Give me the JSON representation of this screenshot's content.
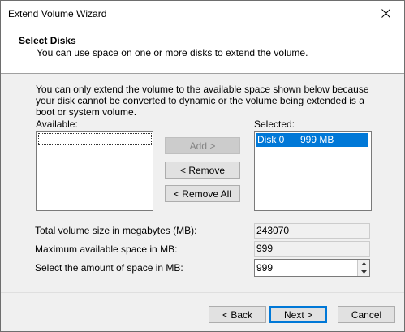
{
  "window": {
    "title": "Extend Volume Wizard"
  },
  "header": {
    "title": "Select Disks",
    "subtitle": "You can use space on one or more disks to extend the volume."
  },
  "info": {
    "text": "You can only extend the volume to the available space shown below because your disk cannot be converted to dynamic or the volume being extended is a boot or system volume."
  },
  "available": {
    "label": "Available:",
    "items": []
  },
  "selected": {
    "label": "Selected:",
    "items": [
      {
        "disk": "Disk 0",
        "size": "999 MB"
      }
    ]
  },
  "buttons": {
    "add": "Add >",
    "remove": "< Remove",
    "remove_all": "< Remove All",
    "back": "< Back",
    "next": "Next >",
    "cancel": "Cancel"
  },
  "fields": {
    "total_label": "Total volume size in megabytes (MB):",
    "total_value": "243070",
    "max_label": "Maximum available space in MB:",
    "max_value": "999",
    "amount_label": "Select the amount of space in MB:",
    "amount_value": "999"
  },
  "icons": {
    "close": "close-icon",
    "spin_up": "spin-up-icon",
    "spin_down": "spin-down-icon"
  }
}
